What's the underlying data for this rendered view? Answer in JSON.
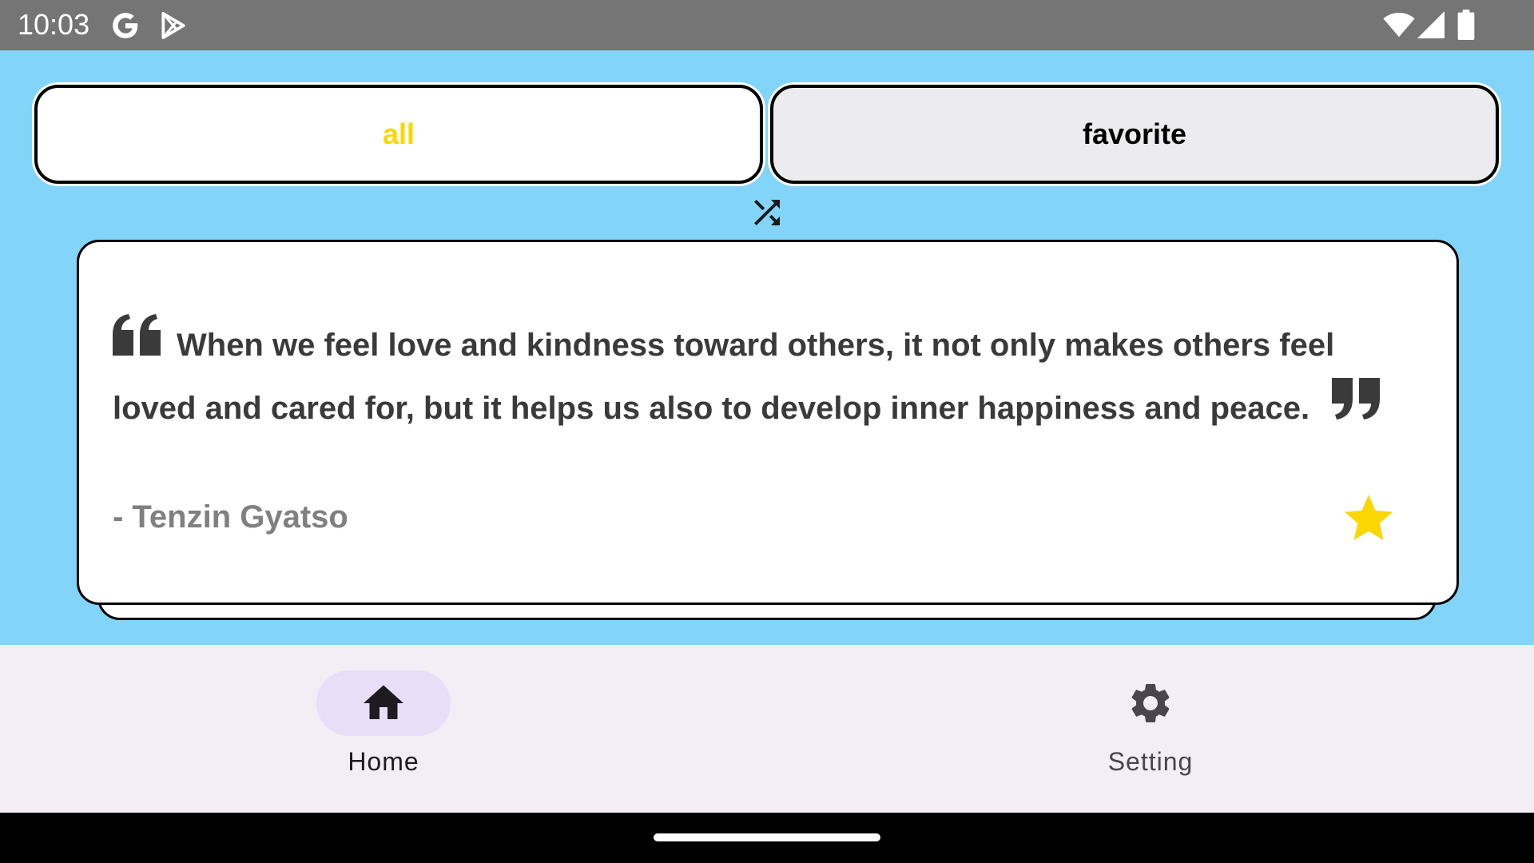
{
  "status_bar": {
    "time": "10:03",
    "left_icons": [
      "google-icon",
      "play-store-icon"
    ],
    "right_icons": [
      "wifi-icon",
      "signal-icon",
      "battery-icon"
    ]
  },
  "tabs": [
    {
      "label": "all",
      "selected": true
    },
    {
      "label": "favorite",
      "selected": false
    }
  ],
  "shuffle": {
    "icon": "shuffle-icon"
  },
  "quote_card": {
    "text": "When we feel love and kindness toward others, it not only makes others feel loved and cared for, but it helps us also to develop inner happiness and peace.",
    "author": "- Tenzin Gyatso",
    "favorite": true,
    "icons": [
      "quote-open-icon",
      "quote-close-icon",
      "star-icon"
    ]
  },
  "bottom_nav": {
    "items": [
      {
        "label": "Home",
        "icon": "home-icon",
        "active": true
      },
      {
        "label": "Setting",
        "icon": "gear-icon",
        "active": false
      }
    ]
  },
  "colors": {
    "background": "#82d4f9",
    "status_bar": "#757575",
    "selected_tab_text": "#fcd600",
    "unselected_tab_bg": "#ececee",
    "star": "#fcd600",
    "quote_text": "#3a3a3a",
    "author_text": "#808080",
    "nav_bg": "#f3edf6",
    "nav_active_pill": "#e8def8"
  }
}
